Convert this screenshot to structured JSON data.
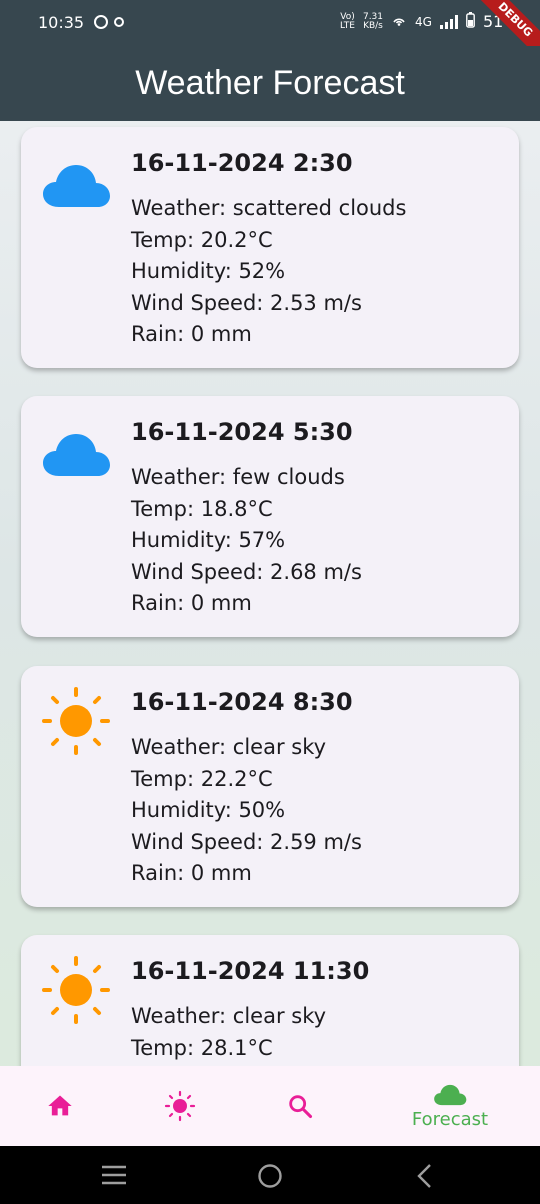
{
  "status_bar": {
    "time": "10:35",
    "net_top": "7.31",
    "net_bottom": "KB/s",
    "volte_top": "Vo)",
    "volte_bottom": "LTE",
    "network": "4G",
    "battery": "51",
    "debug_banner": "DEBUG"
  },
  "app_bar": {
    "title": "Weather Forecast"
  },
  "forecast": [
    {
      "date": "16-11-2024 2:30",
      "weather": "Weather: scattered clouds",
      "temp": "Temp: 20.2°C",
      "humidity": "Humidity: 52%",
      "wind": "Wind Speed: 2.53 m/s",
      "rain": "Rain: 0 mm",
      "icon": "cloud-icon"
    },
    {
      "date": "16-11-2024 5:30",
      "weather": "Weather: few clouds",
      "temp": "Temp: 18.8°C",
      "humidity": "Humidity: 57%",
      "wind": "Wind Speed: 2.68 m/s",
      "rain": "Rain: 0 mm",
      "icon": "cloud-icon"
    },
    {
      "date": "16-11-2024 8:30",
      "weather": "Weather: clear sky",
      "temp": "Temp: 22.2°C",
      "humidity": "Humidity: 50%",
      "wind": "Wind Speed: 2.59 m/s",
      "rain": "Rain: 0 mm",
      "icon": "sun-icon"
    },
    {
      "date": "16-11-2024 11:30",
      "weather": "Weather: clear sky",
      "temp": "Temp: 28.1°C",
      "humidity": "",
      "wind": "",
      "rain": "",
      "icon": "sun-icon"
    }
  ],
  "bottom_nav": {
    "items": [
      {
        "icon": "home-icon",
        "label": ""
      },
      {
        "icon": "sun-icon",
        "label": ""
      },
      {
        "icon": "search-icon",
        "label": ""
      },
      {
        "icon": "cloud-icon",
        "label": "Forecast"
      }
    ],
    "active_index": 3
  },
  "colors": {
    "app_bar": "#37474f",
    "cloud": "#2196f3",
    "sun": "#ff9800",
    "nav_inactive": "#e91e97",
    "nav_active": "#4caf50",
    "card": "#f4f1f8"
  }
}
